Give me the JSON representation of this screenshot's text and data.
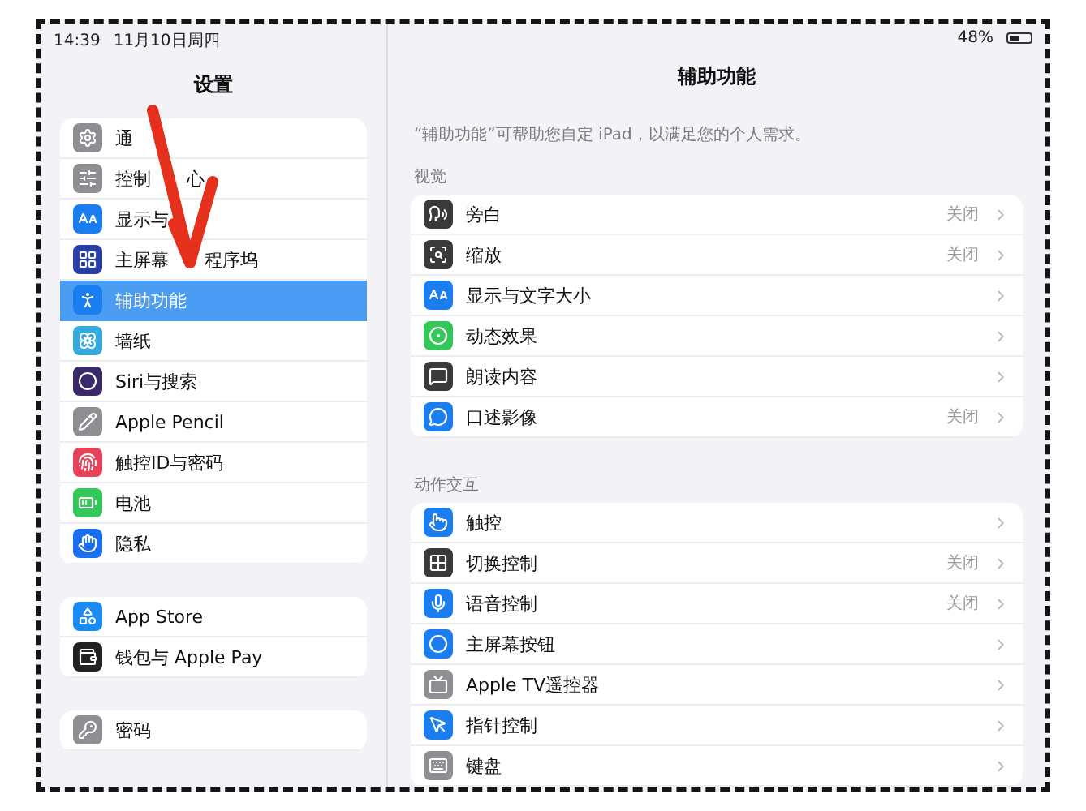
{
  "status_bar": {
    "time": "14:39",
    "date": "11月10日周四",
    "battery": "48%"
  },
  "sidebar": {
    "title": "设置",
    "groups": [
      {
        "items": [
          {
            "label": "通",
            "selected": false
          },
          {
            "label": "控制",
            "label_after": "心",
            "selected": false
          },
          {
            "label": "显示与",
            "selected": false
          },
          {
            "label": "主屏幕",
            "label_after": "程序坞",
            "selected": false
          },
          {
            "label": "辅助功能",
            "selected": true
          },
          {
            "label": "墙纸",
            "selected": false
          },
          {
            "label": "Siri与搜索",
            "selected": false
          },
          {
            "label": "Apple Pencil",
            "selected": false
          },
          {
            "label": "触控ID与密码",
            "selected": false
          },
          {
            "label": "电池",
            "selected": false
          },
          {
            "label": "隐私",
            "selected": false
          }
        ]
      },
      {
        "items": [
          {
            "label": "App Store",
            "selected": false
          },
          {
            "label": "钱包与 Apple Pay",
            "selected": false
          }
        ]
      },
      {
        "items": [
          {
            "label": "密码",
            "selected": false
          }
        ]
      }
    ]
  },
  "main": {
    "title": "辅助功能",
    "description": "“辅助功能”可帮助您自定 iPad，以满足您的个人需求。",
    "sections": [
      {
        "header": "视觉",
        "rows": [
          {
            "label": "旁白",
            "value": "关闭"
          },
          {
            "label": "缩放",
            "value": "关闭"
          },
          {
            "label": "显示与文字大小"
          },
          {
            "label": "动态效果"
          },
          {
            "label": "朗读内容"
          },
          {
            "label": "口述影像",
            "value": "关闭"
          }
        ]
      },
      {
        "header": "动作交互",
        "rows": [
          {
            "label": "触控"
          },
          {
            "label": "切换控制",
            "value": "关闭"
          },
          {
            "label": "语音控制",
            "value": "关闭"
          },
          {
            "label": "主屏幕按钮"
          },
          {
            "label": "Apple TV遥控器"
          },
          {
            "label": "指针控制"
          },
          {
            "label": "键盘"
          }
        ]
      }
    ]
  }
}
